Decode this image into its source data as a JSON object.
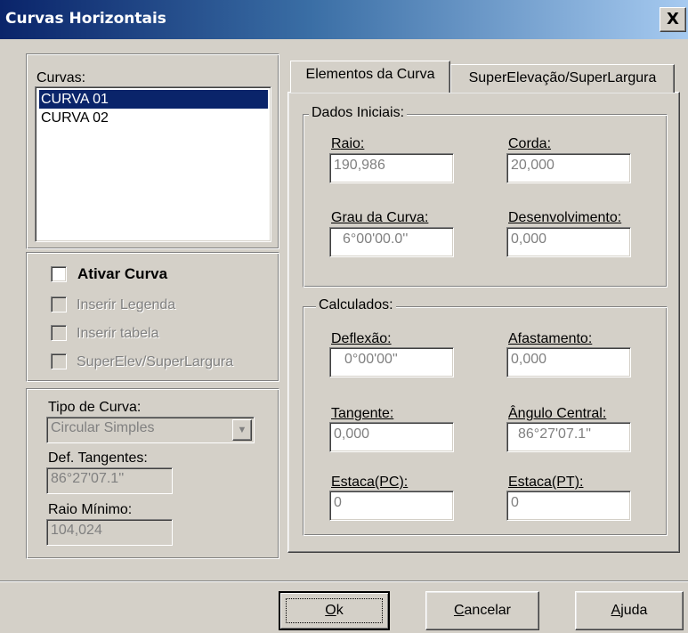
{
  "window": {
    "title": "Curvas Horizontais",
    "close_glyph": "X"
  },
  "curves_list": {
    "label": "Curvas:",
    "items": [
      "CURVA 01",
      "CURVA 02"
    ],
    "selected_index": 0
  },
  "options": {
    "ativar_curva": "Ativar Curva",
    "inserir_legenda": "Inserir Legenda",
    "inserir_tabela": "Inserir tabela",
    "superelev": "SuperElev/SuperLargura"
  },
  "curve_type": {
    "tipo_label": "Tipo de Curva:",
    "tipo_value": "Circular Simples",
    "def_tangentes_label": "Def. Tangentes:",
    "def_tangentes_value": "86°27'07.1''",
    "raio_minimo_label": "Raio Mínimo:",
    "raio_minimo_value": "104,024"
  },
  "tabs": [
    {
      "label": "Elementos da Curva",
      "active": true
    },
    {
      "label": "SuperElevação/SuperLargura",
      "active": false
    }
  ],
  "dados_iniciais": {
    "caption": "Dados Iniciais:",
    "raio_label": "Raio:",
    "raio_value": "190,986",
    "corda_label": "Corda:",
    "corda_value": "20,000",
    "grau_label": "Grau da Curva:",
    "grau_value": "6°00'00.0''",
    "desenv_label": "Desenvolvimento:",
    "desenv_value": "0,000"
  },
  "calculados": {
    "caption": "Calculados:",
    "deflexao_label": "Deflexão:",
    "deflexao_value": "0°00'00\"",
    "afastamento_label": "Afastamento:",
    "afastamento_value": "0,000",
    "tangente_label": "Tangente:",
    "tangente_value": "0,000",
    "angulo_label": "Ângulo Central:",
    "angulo_value": "86°27'07.1\"",
    "estaca_pc_label": "Estaca(PC):",
    "estaca_pc_value": "0",
    "estaca_pt_label": "Estaca(PT):",
    "estaca_pt_value": "0"
  },
  "buttons": {
    "ok": {
      "first": "O",
      "rest": "k"
    },
    "cancelar": {
      "first": "C",
      "rest": "ancelar"
    },
    "ajuda": {
      "first": "A",
      "rest": "juda"
    }
  },
  "icons": [
    "close-icon",
    "checkbox-icon",
    "dropdown-arrow-icon"
  ]
}
